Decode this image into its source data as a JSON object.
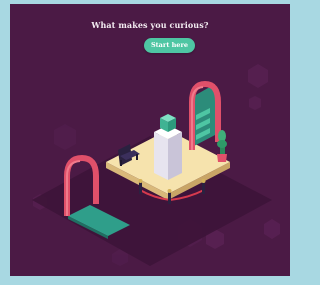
{
  "hero": {
    "headline": "What makes you curious?",
    "cta_label": "Start here"
  },
  "colors": {
    "panel_bg": "#4b1a45",
    "accent_teal": "#4ec6a3",
    "arch_pink": "#e0506a",
    "platform_cream": "#f6e3ad",
    "outer_bg": "#a8d8e2"
  },
  "icons": [
    "cube-icon",
    "armchair-icon",
    "plant-icon",
    "arch-icon",
    "stairs-icon"
  ]
}
